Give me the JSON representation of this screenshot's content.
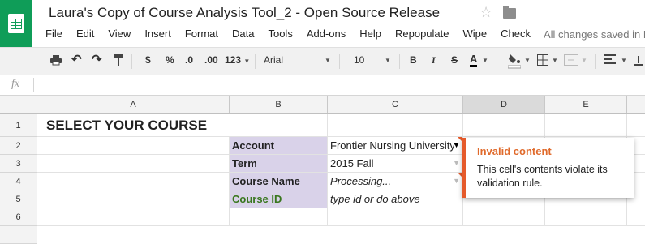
{
  "title": "Laura's Copy of Course Analysis Tool_2 - Open Source Release",
  "menu": [
    "File",
    "Edit",
    "View",
    "Insert",
    "Format",
    "Data",
    "Tools",
    "Add-ons",
    "Help",
    "Repopulate",
    "Wipe",
    "Check"
  ],
  "save_status": "All changes saved in D",
  "toolbar": {
    "currency": "$",
    "percent": "%",
    "dec_decrease": ".0",
    "dec_increase": ".00",
    "number_format": "123",
    "font": "Arial",
    "font_size": "10",
    "bold": "B",
    "italic": "I",
    "strike": "S",
    "text_color": "A"
  },
  "formula_bar": {
    "fx": "fx",
    "value": ""
  },
  "columns": [
    "A",
    "B",
    "C",
    "D",
    "E"
  ],
  "rows": [
    "1",
    "2",
    "3",
    "4",
    "5",
    "6"
  ],
  "cells": {
    "a1": "SELECT YOUR COURSE",
    "b2": "Account",
    "b3": "Term",
    "b4": "Course Name",
    "b5": "Course ID",
    "c2": "Frontier Nursing University",
    "c3": "2015 Fall",
    "c4": "Processing...",
    "c5": "type id or do above"
  },
  "validation_popup": {
    "title": "Invalid content",
    "body": "This cell's contents violate its validation rule."
  },
  "colors": {
    "label_bg": "#d9d2e9",
    "course_id_text": "#38761d",
    "error_accent": "#e55a2b",
    "logo_green": "#0f9d58"
  }
}
